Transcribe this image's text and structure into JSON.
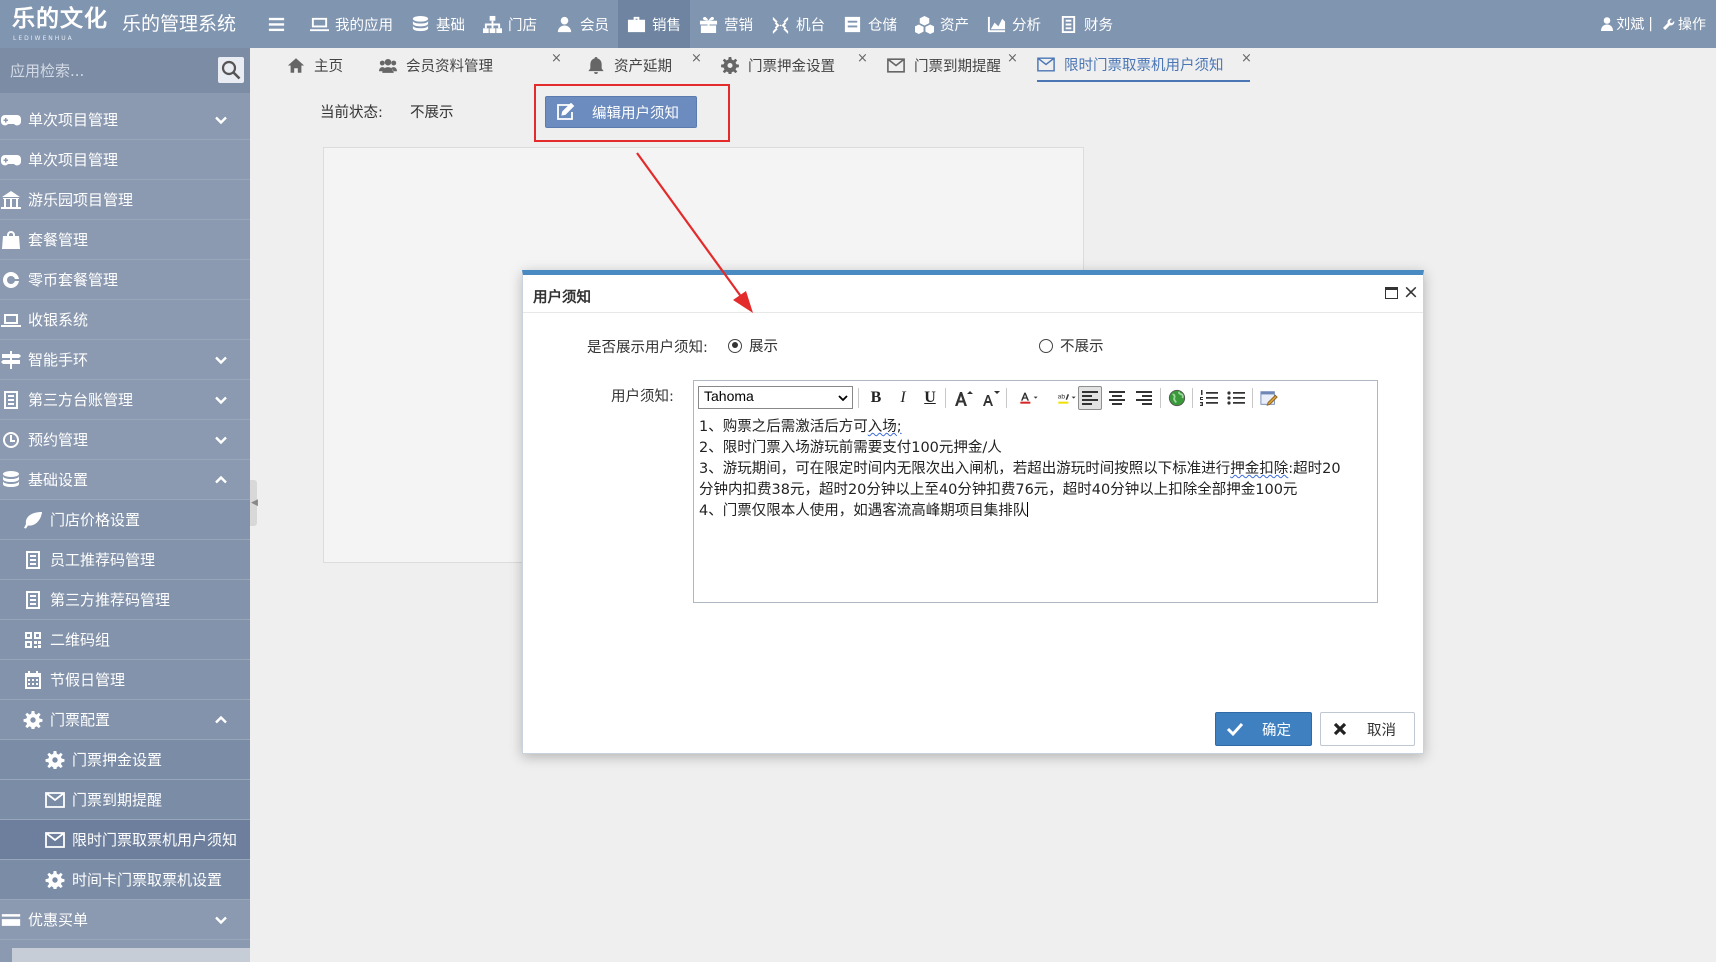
{
  "brand": {
    "logo": "乐的文化",
    "logo_sub": "LEDIWENHUA",
    "system": "乐的管理系统"
  },
  "nav": [
    {
      "label": "我的应用",
      "icon": "monitor-icon"
    },
    {
      "label": "基础",
      "icon": "database-icon"
    },
    {
      "label": "门店",
      "icon": "sitemap-icon"
    },
    {
      "label": "会员",
      "icon": "user-group-icon"
    },
    {
      "label": "销售",
      "icon": "briefcase-icon"
    },
    {
      "label": "营销",
      "icon": "gift-icon"
    },
    {
      "label": "机台",
      "icon": "gamepad-icon"
    },
    {
      "label": "仓储",
      "icon": "box-icon"
    },
    {
      "label": "资产",
      "icon": "cubes-icon"
    },
    {
      "label": "分析",
      "icon": "chart-icon"
    },
    {
      "label": "财务",
      "icon": "ledger-icon"
    }
  ],
  "user": {
    "name": "刘斌",
    "sep": "|",
    "action": "操作"
  },
  "sidebar": {
    "search_placeholder": "应用检索...",
    "items": [
      {
        "label": "单次项目管理"
      },
      {
        "label": "单次项目管理"
      },
      {
        "label": "游乐园项目管理"
      },
      {
        "label": "套餐管理"
      },
      {
        "label": "零币套餐管理"
      },
      {
        "label": "收银系统"
      },
      {
        "label": "智能手环"
      },
      {
        "label": "第三方台账管理"
      },
      {
        "label": "预约管理"
      },
      {
        "label": "基础设置"
      },
      {
        "label": "门店价格设置"
      },
      {
        "label": "员工推荐码管理"
      },
      {
        "label": "第三方推荐码管理"
      },
      {
        "label": "二维码组"
      },
      {
        "label": "节假日管理"
      },
      {
        "label": "门票配置"
      },
      {
        "label": "门票押金设置"
      },
      {
        "label": "门票到期提醒"
      },
      {
        "label": "限时门票取票机用户须知"
      },
      {
        "label": "时间卡门票取票机设置"
      },
      {
        "label": "优惠买单"
      }
    ]
  },
  "tabs": [
    {
      "label": "主页"
    },
    {
      "label": "会员资料管理"
    },
    {
      "label": "资产延期"
    },
    {
      "label": "门票押金设置"
    },
    {
      "label": "门票到期提醒"
    },
    {
      "label": "限时门票取票机用户须知"
    }
  ],
  "tab_close": "×",
  "content": {
    "status_label": "当前状态:",
    "status_value": "不展示",
    "edit_button": "编辑用户须知"
  },
  "dialog": {
    "title": "用户须知",
    "close": "×",
    "show_label": "是否展示用户须知:",
    "option_show": "展示",
    "option_hide": "不展示",
    "notice_label": "用户须知:",
    "font": "Tahoma",
    "toolbar": {
      "bold": "B",
      "italic": "I",
      "underline": "U"
    },
    "lines": {
      "l1": "1、购票之后需激活后方可",
      "l1u": "入场;",
      "l2": "2、限时门票入场游玩前需要支付100元押金/人",
      "l3a": "3、游玩期间，可在限定时间内无限次出入闸机，若超出游玩时间按照以下标准进行",
      "l3u": "押金扣除",
      "l3b": ":超时20",
      "l4": "分钟内扣费38元，超时20分钟以上至40分钟扣费76元，超时40分钟以上扣除全部押金100元",
      "l5": "4、门票仅限本人使用，如遇客流高峰期项目集排队"
    },
    "ok": "确定",
    "cancel": "取消"
  },
  "colors": {
    "topbar": "#8095b0",
    "sidebar": "#8b9ab0",
    "accent": "#4a8ac2",
    "annotation": "#e32b2b"
  }
}
